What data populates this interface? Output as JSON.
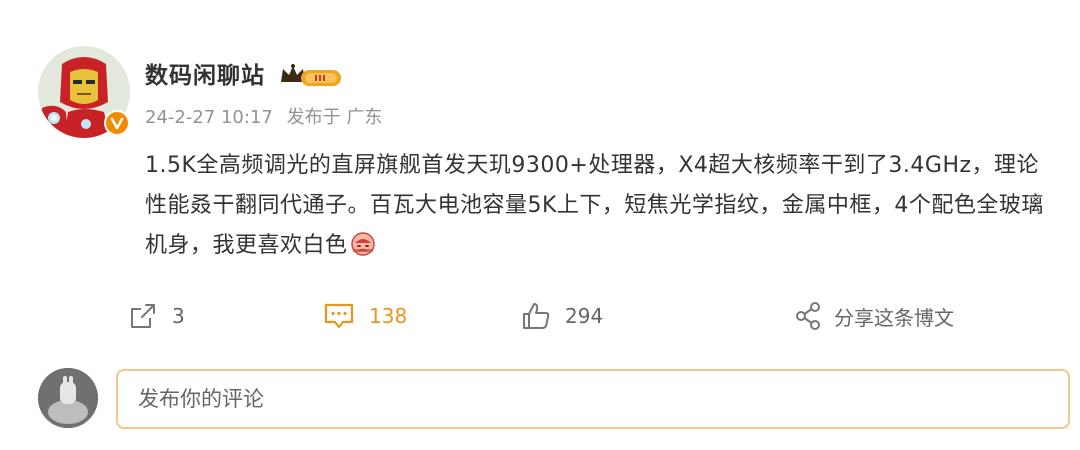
{
  "post": {
    "username": "数码闲聊站",
    "date": "24-2-27 10:17",
    "published_from": "发布于 广东",
    "body": "1.5K全高频调光的直屏旗舰首发天玑9300+处理器，X4超大核频率干到了3.4GHz，理论性能叒干翻同代通子。百瓦大电池容量5K上下，短焦光学指纹，金属中框，4个配色全玻璃机身，我更喜欢白色",
    "emoji_icon": "crying-face-emoji"
  },
  "actions": {
    "repost_count": "3",
    "comment_count": "138",
    "like_count": "294",
    "share_label": "分享这条博文"
  },
  "comment": {
    "placeholder": "发布你的评论"
  },
  "icons": {
    "repost": "repost-icon",
    "comment": "comment-icon",
    "like": "thumbs-up-icon",
    "share": "share-icon",
    "verified": "verified-v-icon",
    "crown": "crown-member-icon"
  },
  "colors": {
    "accent": "#e9941c",
    "text": "#333333",
    "meta": "#939393",
    "input_border": "#f2c98a",
    "verified": "#f28b00"
  }
}
